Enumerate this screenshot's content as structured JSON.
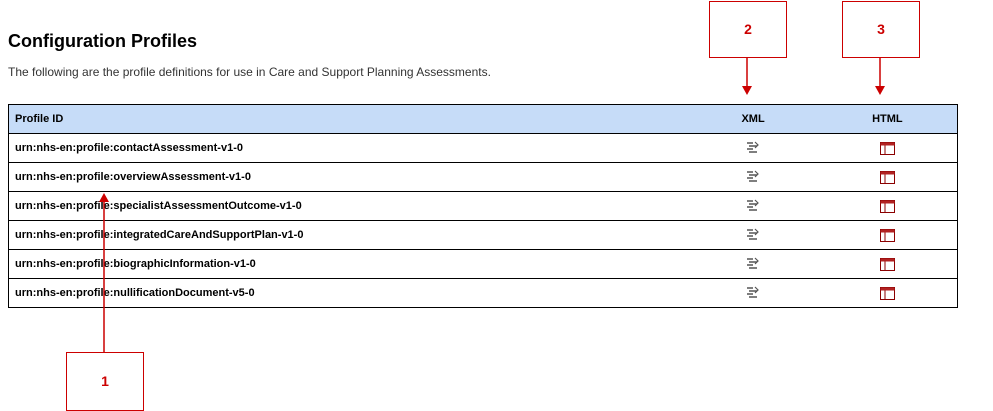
{
  "header": {
    "title": "Configuration Profiles",
    "description": "The following are the profile definitions for use in Care and Support Planning Assessments."
  },
  "table": {
    "columns": [
      "Profile ID",
      "XML",
      "HTML"
    ],
    "rows": [
      {
        "profile_id": "urn:nhs-en:profile:contactAssessment-v1-0",
        "xml_icon": "xml-icon",
        "html_icon": "html-icon"
      },
      {
        "profile_id": "urn:nhs-en:profile:overviewAssessment-v1-0",
        "xml_icon": "xml-icon",
        "html_icon": "html-icon"
      },
      {
        "profile_id": "urn:nhs-en:profile:specialistAssessmentOutcome-v1-0",
        "xml_icon": "xml-icon",
        "html_icon": "html-icon"
      },
      {
        "profile_id": "urn:nhs-en:profile:integratedCareAndSupportPlan-v1-0",
        "xml_icon": "xml-icon",
        "html_icon": "html-icon"
      },
      {
        "profile_id": "urn:nhs-en:profile:biographicInformation-v1-0",
        "xml_icon": "xml-icon",
        "html_icon": "html-icon"
      },
      {
        "profile_id": "urn:nhs-en:profile:nullificationDocument-v5-0",
        "xml_icon": "xml-icon",
        "html_icon": "html-icon"
      }
    ],
    "header_bg_color": "#c6dcf8"
  },
  "callouts": {
    "one": "1",
    "two": "2",
    "three": "3",
    "color": "#cc0000"
  }
}
